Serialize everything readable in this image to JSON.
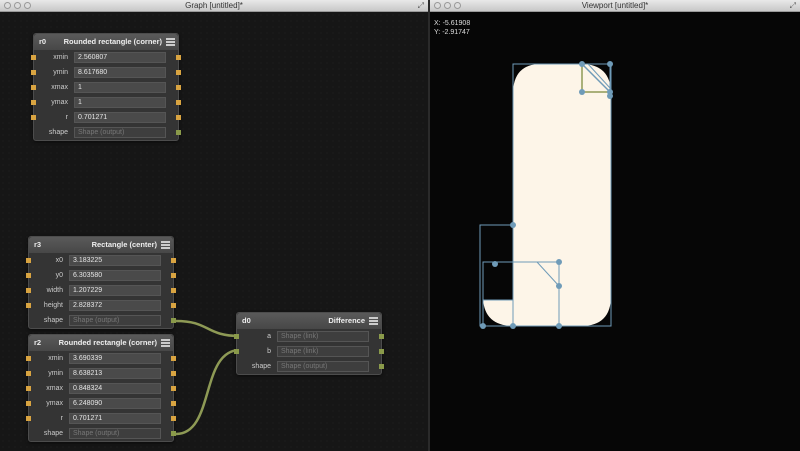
{
  "graph_window": {
    "title": "Graph [untitled]*"
  },
  "viewport_window": {
    "title": "Viewport [untitled]*",
    "x_label": "X:",
    "x_value": "-5.61908",
    "y_label": "Y:",
    "y_value": "-2.91747"
  },
  "colors": {
    "shape_fill": "#fdf5e8",
    "handle": "#6f9bb8",
    "wire": "#8e9a55",
    "port_param": "#d9a441"
  },
  "nodes": {
    "r0": {
      "id": "r0",
      "type": "Rounded rectangle (corner)",
      "rows": [
        {
          "label": "xmin",
          "value": "2.560807"
        },
        {
          "label": "ymin",
          "value": "8.617680"
        },
        {
          "label": "xmax",
          "value": "1"
        },
        {
          "label": "ymax",
          "value": "1"
        },
        {
          "label": "r",
          "value": "0.701271"
        },
        {
          "label": "shape",
          "value": "Shape (output)"
        }
      ]
    },
    "r3": {
      "id": "r3",
      "type": "Rectangle (center)",
      "rows": [
        {
          "label": "x0",
          "value": "3.183225"
        },
        {
          "label": "y0",
          "value": "6.303580"
        },
        {
          "label": "width",
          "value": "1.207229"
        },
        {
          "label": "height",
          "value": "2.828372"
        },
        {
          "label": "shape",
          "value": "Shape (output)"
        }
      ]
    },
    "r2": {
      "id": "r2",
      "type": "Rounded rectangle (corner)",
      "rows": [
        {
          "label": "xmin",
          "value": "3.690339"
        },
        {
          "label": "ymin",
          "value": "8.638213"
        },
        {
          "label": "xmax",
          "value": "0.848324"
        },
        {
          "label": "ymax",
          "value": "6.248090"
        },
        {
          "label": "r",
          "value": "0.701271"
        },
        {
          "label": "shape",
          "value": "Shape (output)"
        }
      ]
    },
    "d0": {
      "id": "d0",
      "type": "Difference",
      "rows": [
        {
          "label": "a",
          "value": "Shape (link)"
        },
        {
          "label": "b",
          "value": "Shape (link)"
        },
        {
          "label": "shape",
          "value": "Shape (output)"
        }
      ]
    }
  }
}
